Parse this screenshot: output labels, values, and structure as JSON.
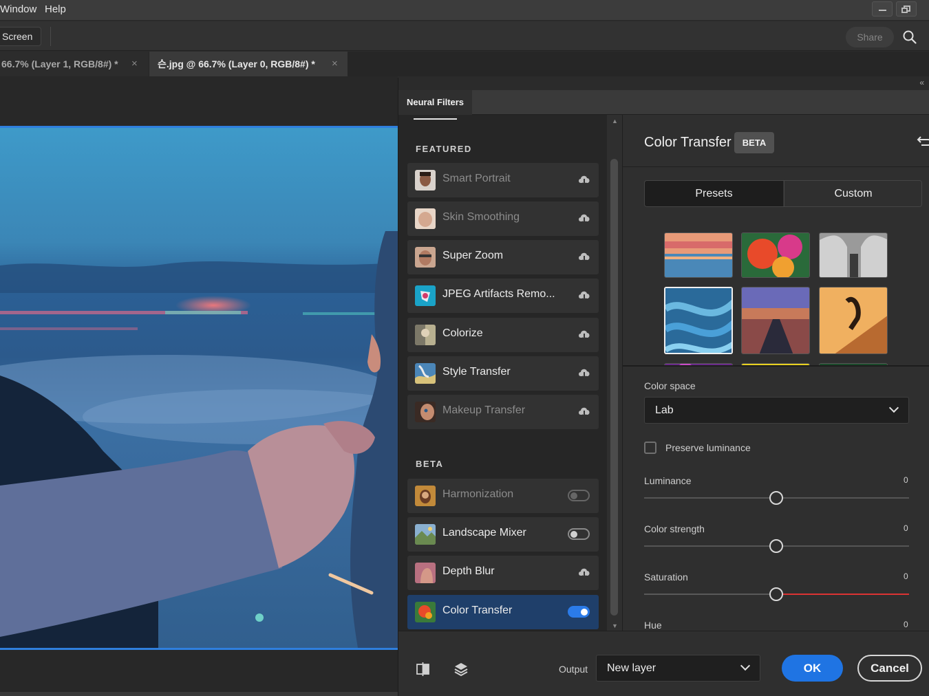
{
  "menu": {
    "items": [
      "Window",
      "Help"
    ]
  },
  "options_bar": {
    "screen_mode": "Screen",
    "share_label": "Share"
  },
  "doc_tabs": [
    {
      "label": "66.7% (Layer 1, RGB/8#) *",
      "close": "×"
    },
    {
      "label": "슨.jpg @ 66.7% (Layer 0, RGB/8#) *",
      "close": "×"
    }
  ],
  "panel": {
    "tab": "Neural Filters",
    "collapse": "«",
    "featured_label": "FEATURED",
    "beta_label": "BETA",
    "featured": [
      {
        "label": "Smart Portrait",
        "dim": true,
        "control": "cloud"
      },
      {
        "label": "Skin Smoothing",
        "dim": true,
        "control": "cloud"
      },
      {
        "label": "Super Zoom",
        "dim": false,
        "control": "cloud"
      },
      {
        "label": "JPEG Artifacts Remo...",
        "dim": false,
        "control": "cloud"
      },
      {
        "label": "Colorize",
        "dim": false,
        "control": "cloud"
      },
      {
        "label": "Style Transfer",
        "dim": false,
        "control": "cloud"
      },
      {
        "label": "Makeup Transfer",
        "dim": true,
        "control": "cloud"
      }
    ],
    "beta": [
      {
        "label": "Harmonization",
        "dim": true,
        "control": "toggle-off"
      },
      {
        "label": "Landscape Mixer",
        "dim": false,
        "control": "toggle-off"
      },
      {
        "label": "Depth Blur",
        "dim": false,
        "control": "cloud"
      },
      {
        "label": "Color Transfer",
        "dim": false,
        "control": "toggle-on",
        "active": true
      }
    ]
  },
  "settings": {
    "title": "Color Transfer",
    "badge": "BETA",
    "segments": [
      "Presets",
      "Custom"
    ],
    "active_segment": "Presets",
    "selected_preset_index": 3,
    "color_space_label": "Color space",
    "color_space_value": "Lab",
    "preserve_luminance_label": "Preserve luminance",
    "preserve_luminance_checked": false,
    "sliders": [
      {
        "label": "Luminance",
        "value": "0"
      },
      {
        "label": "Color strength",
        "value": "0"
      },
      {
        "label": "Saturation",
        "value": "0"
      },
      {
        "label": "Hue",
        "value": "0"
      }
    ]
  },
  "footer": {
    "output_label": "Output",
    "output_value": "New layer",
    "ok_label": "OK",
    "cancel_label": "Cancel"
  },
  "colors": {
    "accent": "#1f74e3",
    "active_item": "#1f3f6a",
    "canvas_border": "#2f7fde"
  },
  "icons": [
    "search-icon",
    "cloud-download-icon",
    "reset-icon",
    "compare-icon",
    "layers-icon",
    "chevron-down-icon",
    "minimize-icon",
    "restore-icon"
  ]
}
